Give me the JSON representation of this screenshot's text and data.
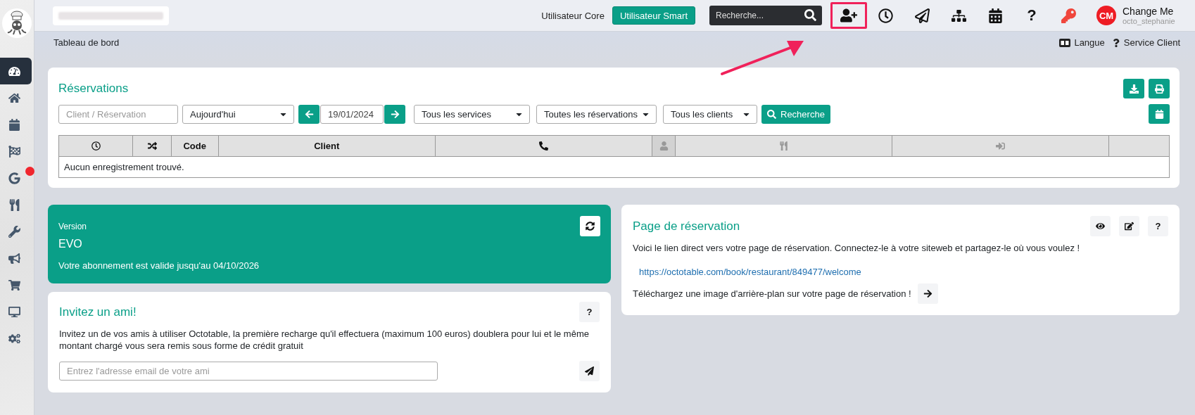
{
  "sidebar": {
    "items": [
      {
        "kind": "dashboard",
        "selected": true,
        "notification": false
      },
      {
        "kind": "home",
        "selected": false,
        "notification": false
      },
      {
        "kind": "calendar",
        "selected": false,
        "notification": false
      },
      {
        "kind": "flag",
        "selected": false,
        "notification": false
      },
      {
        "kind": "google",
        "selected": false,
        "notification": true
      },
      {
        "kind": "utensils",
        "selected": false,
        "notification": false
      },
      {
        "kind": "wrench",
        "selected": false,
        "notification": false
      },
      {
        "kind": "bullhorn",
        "selected": false,
        "notification": false
      },
      {
        "kind": "cart",
        "selected": false,
        "notification": false
      },
      {
        "kind": "desktop",
        "selected": false,
        "notification": false
      },
      {
        "kind": "cogs",
        "selected": false,
        "notification": false
      }
    ]
  },
  "topbar": {
    "user_modes": [
      {
        "label": "Utilisateur Core",
        "selected": false
      },
      {
        "label": "Utilisateur Smart",
        "selected": true
      }
    ],
    "search": {
      "placeholder": "Recherche..."
    },
    "tools": [
      {
        "kind": "user-plus",
        "highlighted": true
      },
      {
        "kind": "clock",
        "highlighted": false
      },
      {
        "kind": "send",
        "highlighted": false
      },
      {
        "kind": "sitemap",
        "highlighted": false
      },
      {
        "kind": "calendar",
        "highlighted": false
      },
      {
        "kind": "help",
        "label": "?",
        "highlighted": false
      },
      {
        "kind": "key",
        "highlighted": false
      }
    ],
    "user": {
      "initials": "CM",
      "name": "Change Me",
      "login": "octo_stephanie"
    }
  },
  "breadcrumb": "Tableau de bord",
  "header_links": [
    {
      "kind": "language",
      "label": "Langue"
    },
    {
      "kind": "help",
      "label": "Service Client"
    }
  ],
  "reservations": {
    "title": "Réservations",
    "search": {
      "placeholder": "Client / Réservation"
    },
    "period": "Aujourd'hui",
    "date": "19/01/2024",
    "filters": [
      "Tous les services",
      "Toutes les réservations",
      "Tous les clients"
    ],
    "search_button": "Recherche",
    "columns": [
      {
        "kind": "clock"
      },
      {
        "kind": "shuffle"
      },
      {
        "kind": "text",
        "label": "Code"
      },
      {
        "kind": "text",
        "label": "Client"
      },
      {
        "kind": "phone"
      },
      {
        "kind": "user"
      },
      {
        "kind": "utensils"
      },
      {
        "kind": "sign-in"
      },
      {
        "kind": "blank"
      }
    ],
    "empty": "Aucun enregistrement trouvé."
  },
  "version": {
    "label": "Version",
    "name": "EVO",
    "validity": "Votre abonnement est valide jusqu'au 04/10/2026"
  },
  "invite": {
    "title": "Invitez un ami!",
    "help": "?",
    "text": "Invitez un de vos amis à utiliser Octotable, la première recharge qu'il effectuera (maximum 100 euros) doublera pour lui et le même montant chargé vous sera remis sous forme de crédit gratuit",
    "email": {
      "placeholder": "Entrez l'adresse email de votre ami"
    }
  },
  "booking_page": {
    "title": "Page de réservation",
    "help": "?",
    "text": "Voici le lien direct vers votre page de réservation. Connectez-le à votre siteweb et partagez-le où vous voulez !",
    "link": "https://octotable.com/book/restaurant/849477/welcome",
    "upload": "Téléchargez une image d'arrière-plan sur votre page de réservation !"
  }
}
